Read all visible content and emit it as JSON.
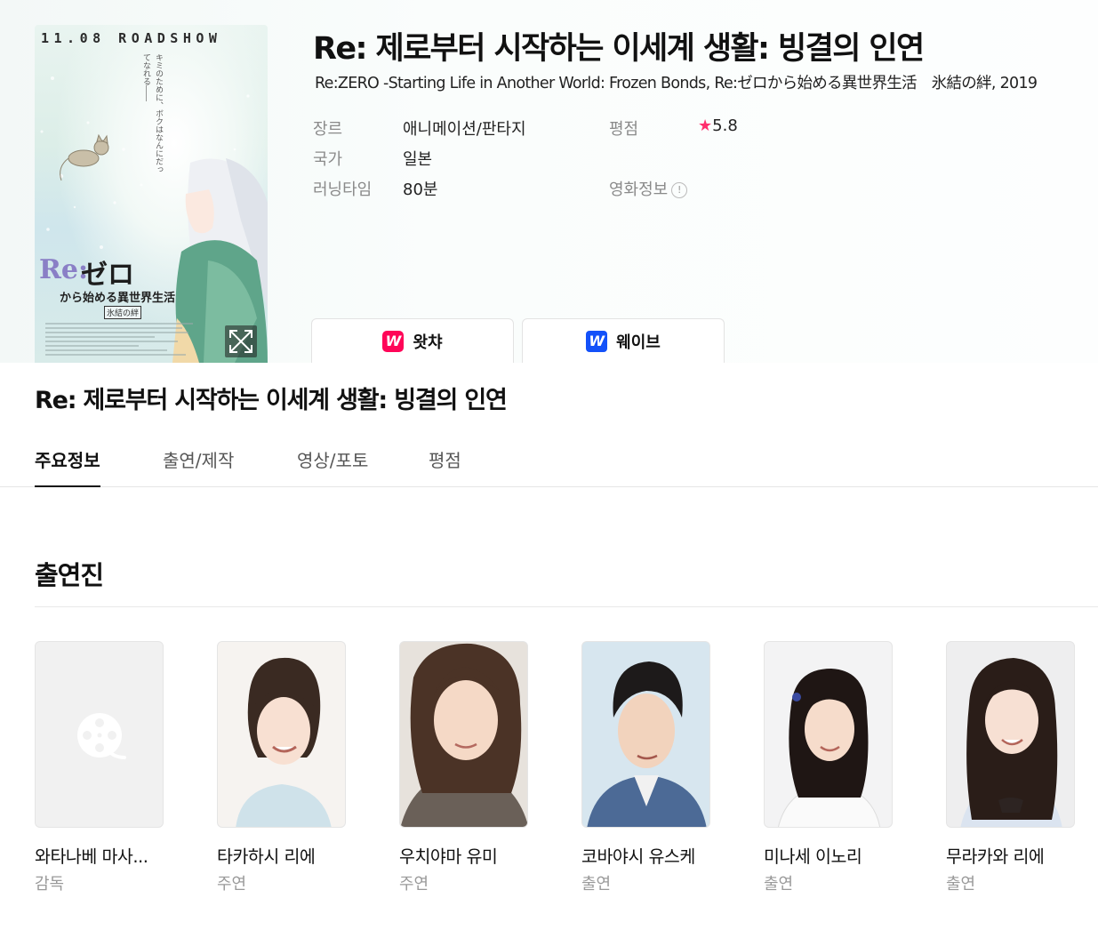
{
  "poster": {
    "roadshow_text": "11.08 ROADSHOW",
    "tagline_jp": "キミのために、ボクはなんにだってなれる――",
    "logo_re": "Re:",
    "logo_zero": "ゼロ",
    "logo_sub": "から始める異世界生活",
    "logo_tag": "氷結の絆",
    "expand_icon": "expand-icon"
  },
  "movie": {
    "title": "Re: 제로부터 시작하는 이세계 생활: 빙결의 인연",
    "alt_title": "Re:ZERO -Starting Life in Another World: Frozen Bonds, Re:ゼロから始める異世界生活　氷結の絆, 2019",
    "genre_label": "장르",
    "genre": "애니메이션/판타지",
    "country_label": "국가",
    "country": "일본",
    "runtime_label": "러닝타임",
    "runtime": "80분",
    "rating_label": "평점",
    "rating_star": "★",
    "rating": "5.8",
    "movieinfo_label": "영화정보",
    "movieinfo_icon": "!"
  },
  "ott": [
    {
      "logo": "W",
      "label": "왓챠",
      "color": "#ff0558"
    },
    {
      "logo": "W",
      "label": "웨이브",
      "color": "#1351f9"
    }
  ],
  "subtitle": "Re: 제로부터 시작하는 이세계 생활: 빙결의 인연",
  "tabs": [
    {
      "label": "주요정보",
      "active": true
    },
    {
      "label": "출연/제작",
      "active": false
    },
    {
      "label": "영상/포토",
      "active": false
    },
    {
      "label": "평점",
      "active": false
    }
  ],
  "cast_section": {
    "title": "출연진",
    "members": [
      {
        "name": "와타나베 마사...",
        "role": "감독",
        "photo": "placeholder-film-icon"
      },
      {
        "name": "타카하시 리에",
        "role": "주연",
        "photo": "portrait"
      },
      {
        "name": "우치야마 유미",
        "role": "주연",
        "photo": "portrait"
      },
      {
        "name": "코바야시 유스케",
        "role": "출연",
        "photo": "portrait"
      },
      {
        "name": "미나세 이노리",
        "role": "출연",
        "photo": "portrait"
      },
      {
        "name": "무라카와 리에",
        "role": "출연",
        "photo": "portrait"
      }
    ]
  }
}
